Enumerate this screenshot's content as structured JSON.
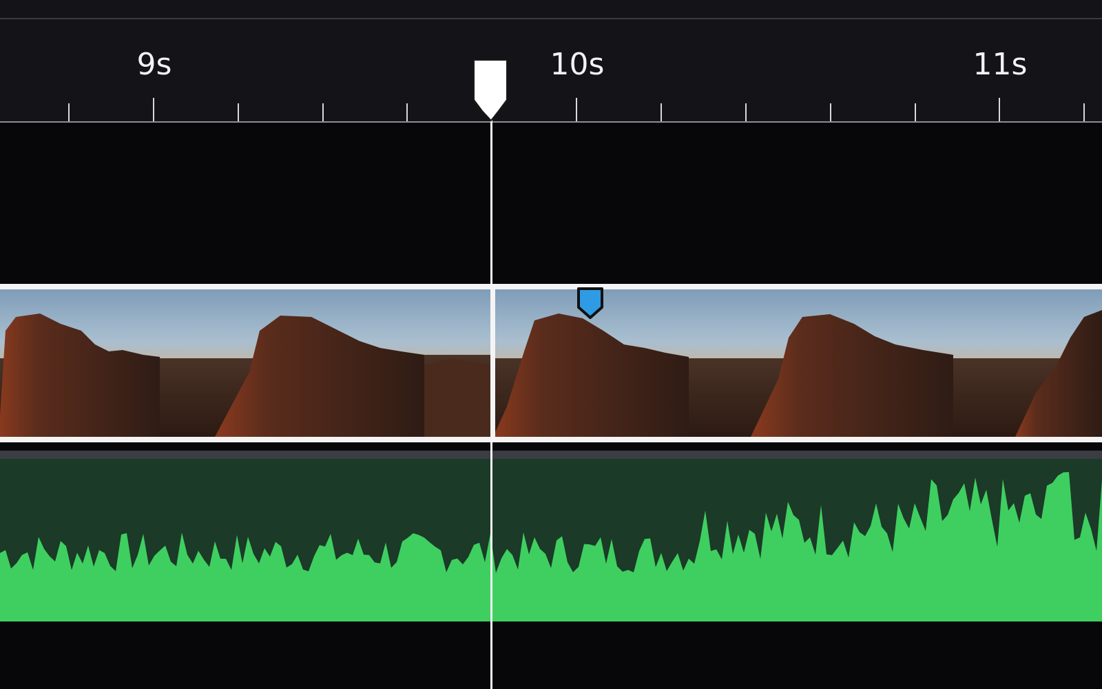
{
  "ruler": {
    "labels": [
      "9s",
      "10s",
      "11s"
    ],
    "major_times_s": [
      9,
      10,
      11
    ],
    "minor_ticks_per_second": 5
  },
  "playhead": {
    "time_s": 9.8
  },
  "marker": {
    "color": "#2f9be4",
    "icon": "marker-icon"
  },
  "video_track": {
    "clip_description_color_sky": "#a9bfd0",
    "border_color": "#f4f4f4"
  },
  "audio_track": {
    "waveform_color": "#3fcf60",
    "background_color": "#1b3a27"
  }
}
